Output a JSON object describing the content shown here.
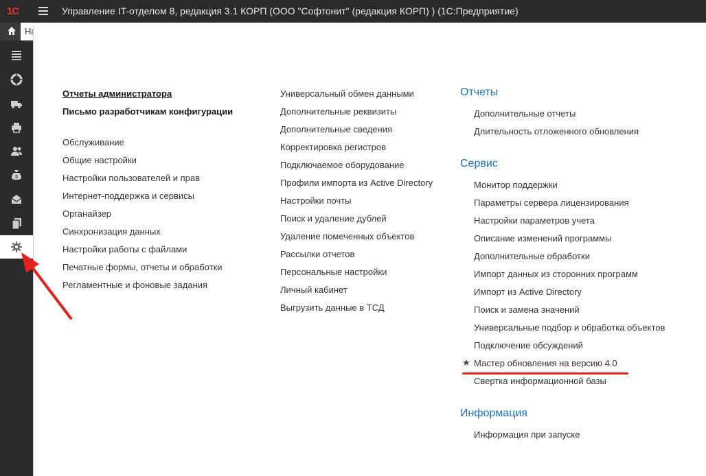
{
  "header": {
    "logo": "1С",
    "title": "Управление IT-отделом 8, редакция 3.1 КОРП (ООО \"Софтонит\" (редакция КОРП) )  (1С:Предприятие)"
  },
  "tab": {
    "label": "На"
  },
  "sidebar": {
    "icons": [
      "menu-lines-icon",
      "lifebuoy-icon",
      "truck-icon",
      "printer-icon",
      "users-icon",
      "money-bag-icon",
      "mail-icon",
      "documents-icon",
      "gear-icon"
    ],
    "active": "gear-icon"
  },
  "col1": {
    "bold_links": [
      "Отчеты администратора",
      "Письмо разработчикам конфигурации"
    ],
    "links": [
      "Обслуживание",
      "Общие настройки",
      "Настройки пользователей и прав",
      "Интернет-поддержка и сервисы",
      "Органайзер",
      "Синхронизация данных",
      "Настройки работы с файлами",
      "Печатные формы, отчеты и обработки",
      "Регламентные и фоновые задания"
    ]
  },
  "col2": {
    "links": [
      "Универсальный обмен данными",
      "Дополнительные реквизиты",
      "Дополнительные сведения",
      "Корректировка регистров",
      "Подключаемое оборудование",
      "Профили импорта из Active Directory",
      "Настройки почты",
      "Поиск и удаление дублей",
      "Удаление помеченных объектов",
      "Рассылки отчетов",
      "Персональные настройки",
      "Личный кабинет",
      "Выгрузить данные в ТСД"
    ]
  },
  "col3": {
    "reports_header": "Отчеты",
    "reports": [
      "Дополнительные отчеты",
      "Длительность отложенного обновления"
    ],
    "service_header": "Сервис",
    "service": [
      "Монитор поддержки",
      "Параметры сервера лицензирования",
      "Настройки параметров учета",
      "Описание изменений программы",
      "Дополнительные обработки",
      "Импорт данных из сторонних программ",
      "Импорт из Active Directory",
      "Поиск и замена значений",
      "Универсальные подбор и обработка объектов",
      "Подключение обсуждений",
      "Мастер обновления на версию 4.0",
      "Свертка информационной базы"
    ],
    "starred": "Мастер обновления на версию 4.0",
    "info_header": "Информация",
    "info": [
      "Информация при запуске"
    ]
  },
  "colors": {
    "accent": "#1a73c9",
    "highlight": "#e2221b",
    "sidebar": "#2b2b2b"
  }
}
